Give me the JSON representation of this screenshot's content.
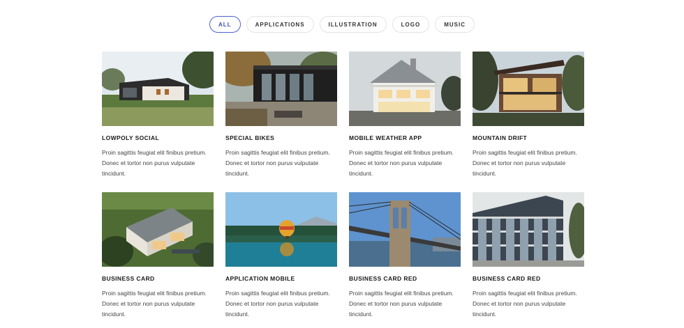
{
  "filters": [
    {
      "label": "ALL",
      "active": true
    },
    {
      "label": "APPLICATIONS",
      "active": false
    },
    {
      "label": "ILLUSTRATION",
      "active": false
    },
    {
      "label": "LOGO",
      "active": false
    },
    {
      "label": "MUSIC",
      "active": false
    }
  ],
  "accent_color": "#4a62d6",
  "items": [
    {
      "title": "LOWPOLY SOCIAL",
      "description": "Proin sagittis feugiat elit finibus pretium. Donec et tortor non purus vulputate tincidunt."
    },
    {
      "title": "SPECIAL BIKES",
      "description": "Proin sagittis feugiat elit finibus pretium. Donec et tortor non purus vulputate tincidunt."
    },
    {
      "title": "MOBILE WEATHER APP",
      "description": "Proin sagittis feugiat elit finibus pretium. Donec et tortor non purus vulputate tincidunt."
    },
    {
      "title": "MOUNTAIN DRIFT",
      "description": "Proin sagittis feugiat elit finibus pretium. Donec et tortor non purus vulputate tincidunt."
    },
    {
      "title": "BUSINESS CARD",
      "description": "Proin sagittis feugiat elit finibus pretium. Donec et tortor non purus vulputate tincidunt."
    },
    {
      "title": "APPLICATION MOBILE",
      "description": "Proin sagittis feugiat elit finibus pretium. Donec et tortor non purus vulputate tincidunt."
    },
    {
      "title": "BUSINESS CARD RED",
      "description": "Proin sagittis feugiat elit finibus pretium. Donec et tortor non purus vulputate tincidunt."
    },
    {
      "title": "BUSINESS CARD RED",
      "description": "Proin sagittis feugiat elit finibus pretium. Donec et tortor non purus vulputate tincidunt."
    }
  ]
}
